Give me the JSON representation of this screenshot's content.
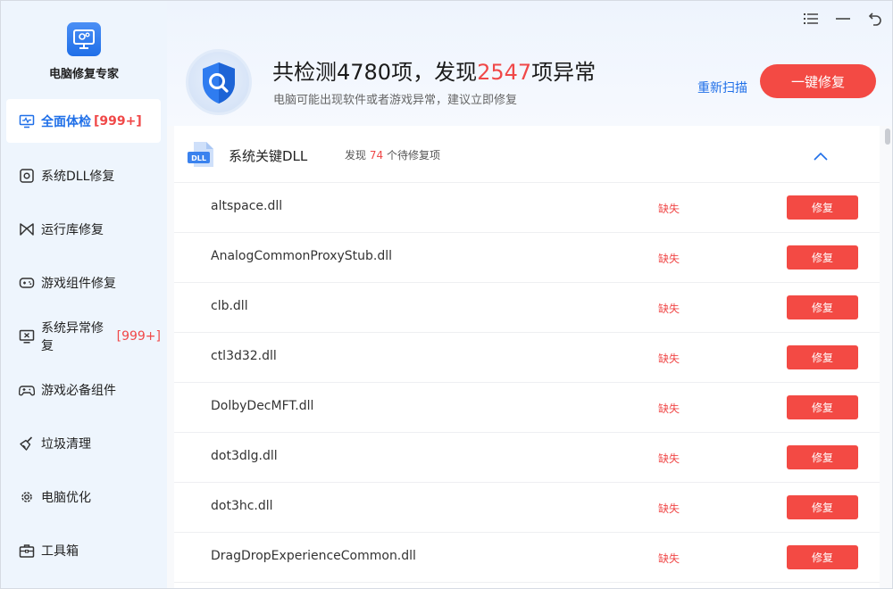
{
  "app": {
    "name": "电脑修复专家"
  },
  "sidebar": {
    "items": [
      {
        "label": "全面体检",
        "badge": "[999+]",
        "icon": "monitor-pulse-icon",
        "active": true
      },
      {
        "label": "系统DLL修复",
        "badge": "",
        "icon": "dll-chip-icon"
      },
      {
        "label": "运行库修复",
        "badge": "",
        "icon": "bowtie-icon"
      },
      {
        "label": "游戏组件修复",
        "badge": "",
        "icon": "gamepad-icon"
      },
      {
        "label": "系统异常修复",
        "badge": "[999+]",
        "icon": "monitor-x-icon"
      },
      {
        "label": "游戏必备组件",
        "badge": "",
        "icon": "controller-icon"
      },
      {
        "label": "垃圾清理",
        "badge": "",
        "icon": "broom-icon"
      },
      {
        "label": "电脑优化",
        "badge": "",
        "icon": "gear-icon"
      },
      {
        "label": "工具箱",
        "badge": "",
        "icon": "toolbox-icon"
      }
    ]
  },
  "header": {
    "headline_prefix": "共检测",
    "total": "4780",
    "headline_mid": "项，发现",
    "found": "2547",
    "headline_suffix": "项异常",
    "subtitle": "电脑可能出现软件或者游戏异常，建议立即修复",
    "rescan_label": "重新扫描",
    "fix_all_label": "一键修复"
  },
  "section": {
    "title": "系统关键DLL",
    "info_prefix": "发现",
    "count": "74",
    "info_suffix": "个待修复项",
    "icon": "dll-file-icon"
  },
  "rows": [
    {
      "name": "altspace.dll",
      "status": "缺失",
      "action": "修复"
    },
    {
      "name": "AnalogCommonProxyStub.dll",
      "status": "缺失",
      "action": "修复"
    },
    {
      "name": "clb.dll",
      "status": "缺失",
      "action": "修复"
    },
    {
      "name": "ctl3d32.dll",
      "status": "缺失",
      "action": "修复"
    },
    {
      "name": "DolbyDecMFT.dll",
      "status": "缺失",
      "action": "修复"
    },
    {
      "name": "dot3dlg.dll",
      "status": "缺失",
      "action": "修复"
    },
    {
      "name": "dot3hc.dll",
      "status": "缺失",
      "action": "修复"
    },
    {
      "name": "DragDropExperienceCommon.dll",
      "status": "缺失",
      "action": "修复"
    }
  ],
  "colors": {
    "accent": "#1f6fe8",
    "danger": "#f04848",
    "button": "#f34a44",
    "sidebar_bg": "#eef5fd"
  }
}
